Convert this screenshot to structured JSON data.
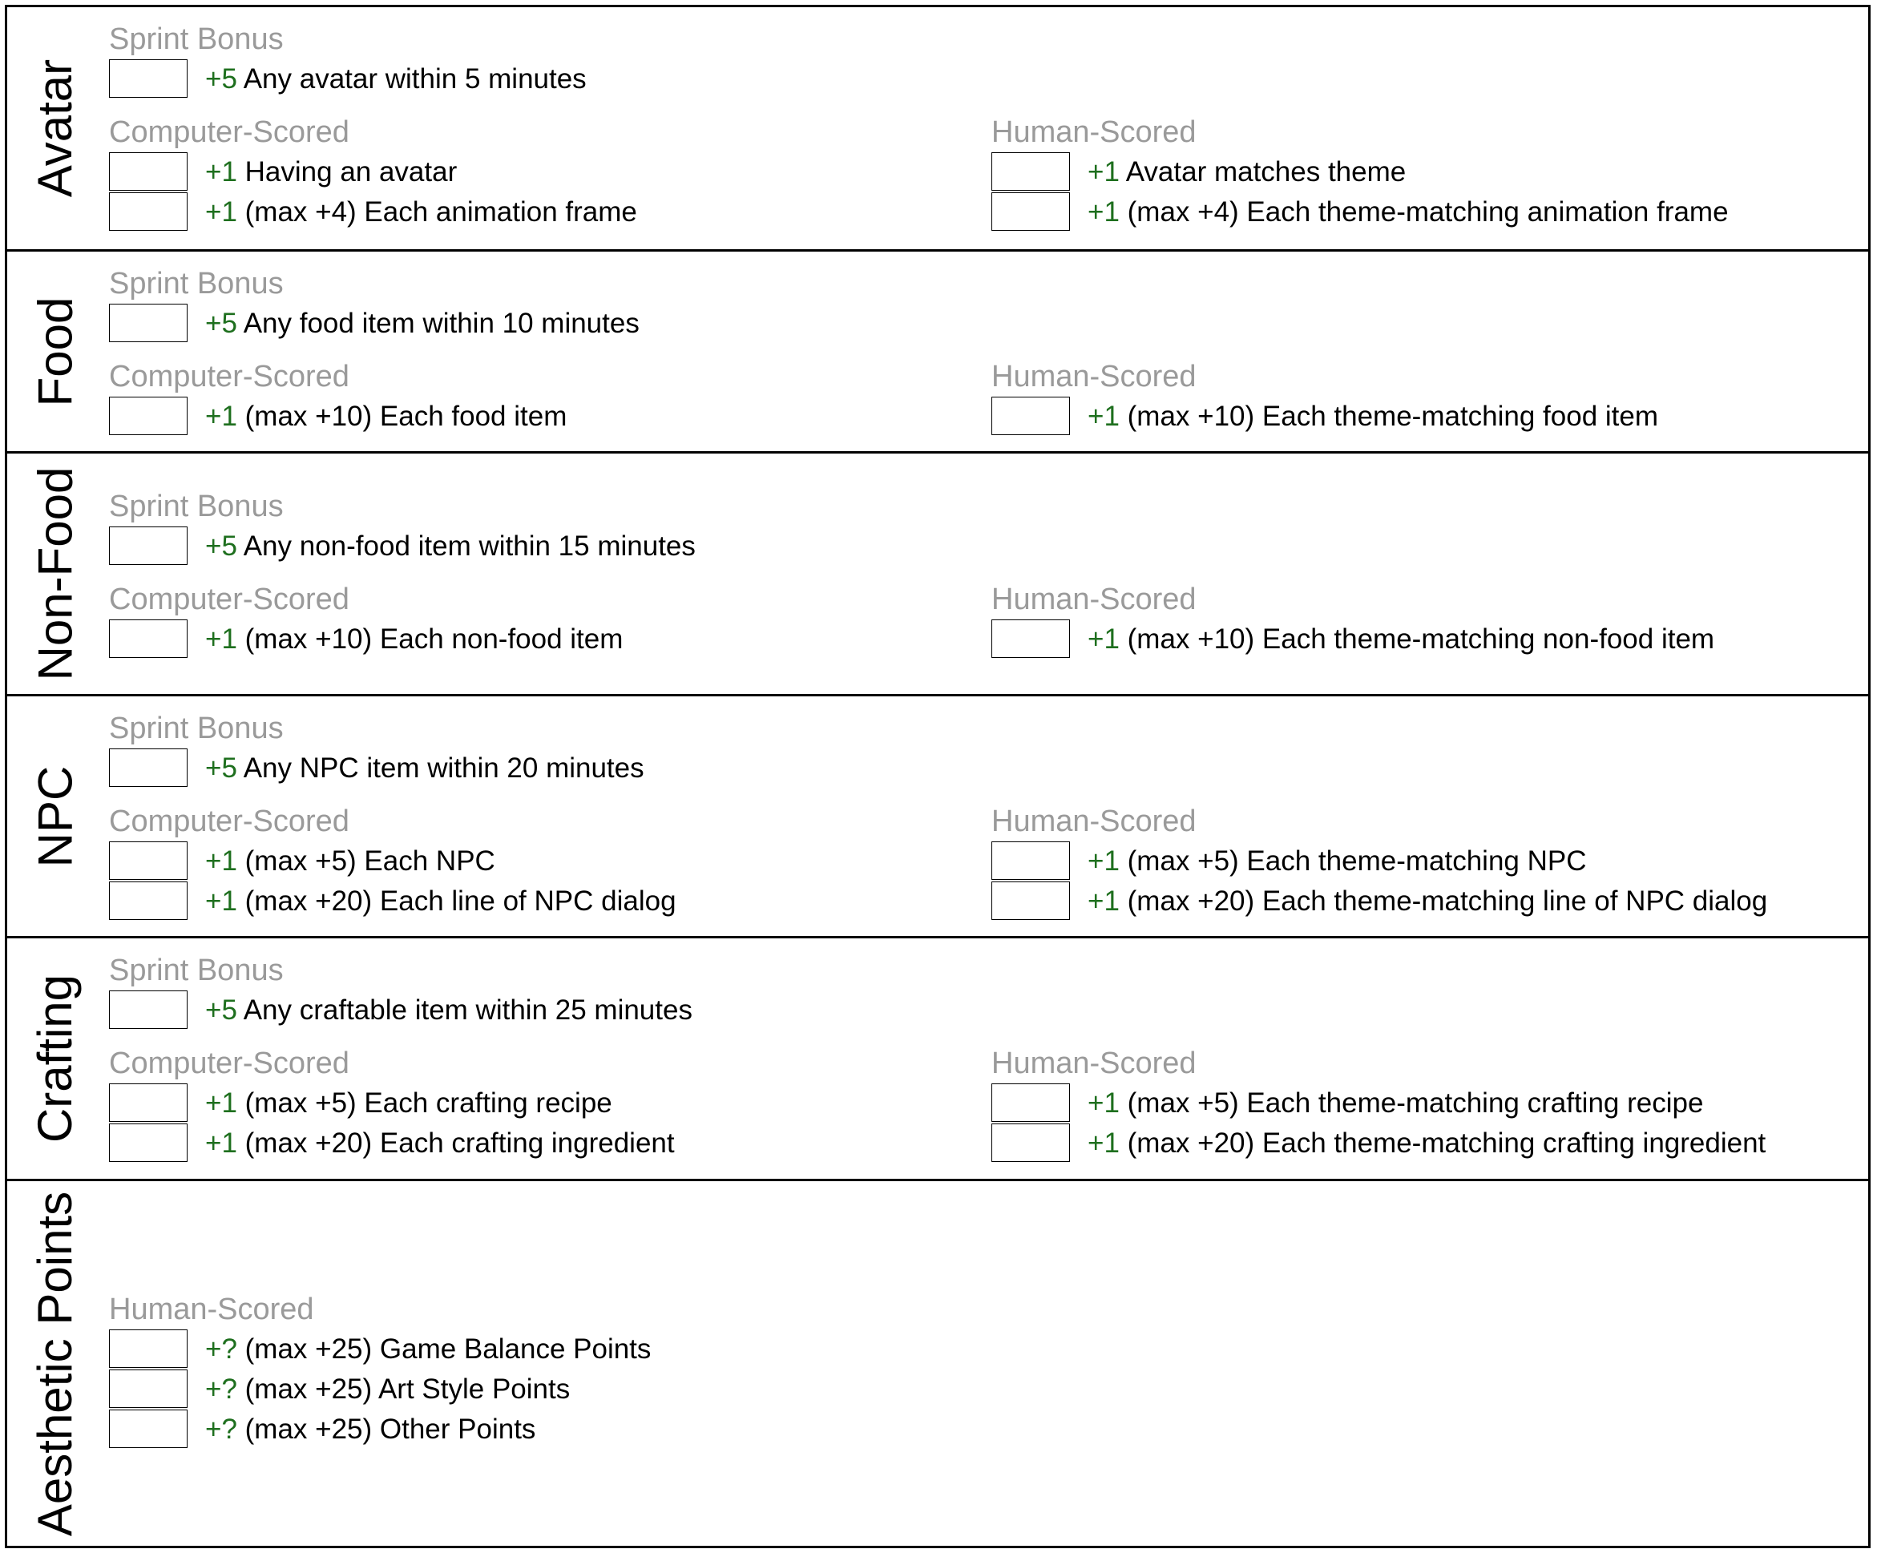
{
  "sections": [
    {
      "title": "Avatar",
      "sprint": {
        "label": "Sprint Bonus",
        "points": "+5",
        "text": "Any avatar within 5 minutes"
      },
      "computer": {
        "label": "Computer-Scored",
        "items": [
          {
            "points": "+1",
            "text": "Having an avatar"
          },
          {
            "points": "+1",
            "text": "(max +4) Each animation frame"
          }
        ]
      },
      "human": {
        "label": "Human-Scored",
        "items": [
          {
            "points": "+1",
            "text": "Avatar matches theme"
          },
          {
            "points": "+1",
            "text": "(max +4) Each theme-matching animation frame"
          }
        ]
      }
    },
    {
      "title": "Food",
      "sprint": {
        "label": "Sprint Bonus",
        "points": "+5",
        "text": "Any food item within 10 minutes"
      },
      "computer": {
        "label": "Computer-Scored",
        "items": [
          {
            "points": "+1",
            "text": "(max +10) Each food item"
          }
        ]
      },
      "human": {
        "label": "Human-Scored",
        "items": [
          {
            "points": "+1",
            "text": "(max +10) Each theme-matching food item"
          }
        ]
      }
    },
    {
      "title": "Non-Food",
      "sprint": {
        "label": "Sprint Bonus",
        "points": "+5",
        "text": "Any non-food item within 15 minutes"
      },
      "computer": {
        "label": "Computer-Scored",
        "items": [
          {
            "points": "+1",
            "text": "(max +10) Each non-food item"
          }
        ]
      },
      "human": {
        "label": "Human-Scored",
        "items": [
          {
            "points": "+1",
            "text": "(max +10) Each theme-matching non-food item"
          }
        ]
      }
    },
    {
      "title": "NPC",
      "sprint": {
        "label": "Sprint Bonus",
        "points": "+5",
        "text": "Any NPC item within 20 minutes"
      },
      "computer": {
        "label": "Computer-Scored",
        "items": [
          {
            "points": "+1",
            "text": "(max +5) Each NPC"
          },
          {
            "points": "+1",
            "text": "(max +20) Each line of NPC dialog"
          }
        ]
      },
      "human": {
        "label": "Human-Scored",
        "items": [
          {
            "points": "+1",
            "text": "(max +5) Each theme-matching NPC"
          },
          {
            "points": "+1",
            "text": "(max +20) Each theme-matching line of NPC dialog"
          }
        ]
      }
    },
    {
      "title": "Crafting",
      "sprint": {
        "label": "Sprint Bonus",
        "points": "+5",
        "text": "Any craftable item within 25 minutes"
      },
      "computer": {
        "label": "Computer-Scored",
        "items": [
          {
            "points": "+1",
            "text": "(max +5) Each crafting recipe"
          },
          {
            "points": "+1",
            "text": "(max +20) Each crafting ingredient"
          }
        ]
      },
      "human": {
        "label": "Human-Scored",
        "items": [
          {
            "points": "+1",
            "text": "(max +5) Each theme-matching crafting recipe"
          },
          {
            "points": "+1",
            "text": "(max +20) Each theme-matching crafting ingredient"
          }
        ]
      }
    },
    {
      "title": "Aesthetic Points",
      "human": {
        "label": "Human-Scored",
        "items": [
          {
            "points": "+?",
            "text": "(max +25) Game Balance Points"
          },
          {
            "points": "+?",
            "text": "(max +25) Art Style Points"
          },
          {
            "points": "+?",
            "text": "(max +25) Other Points"
          }
        ]
      }
    }
  ]
}
